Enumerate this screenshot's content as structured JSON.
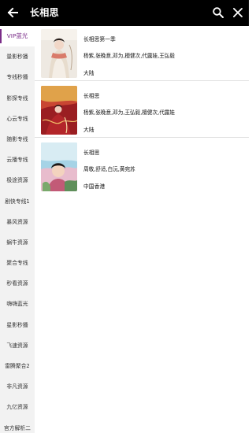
{
  "header": {
    "back_icon": "arrow-left-icon",
    "title": "长相思",
    "search_icon": "search-icon",
    "close_icon": "close-icon"
  },
  "sidebar": {
    "accent_color": "#7a2c88",
    "items": [
      {
        "label": "VIP蓝光",
        "active": true
      },
      {
        "label": "量影秒播"
      },
      {
        "label": "专线秒播"
      },
      {
        "label": "影探专线"
      },
      {
        "label": "心云专线"
      },
      {
        "label": "随影专线"
      },
      {
        "label": "云播专线"
      },
      {
        "label": "极途资源"
      },
      {
        "label": "剧快专线1"
      },
      {
        "label": "暴风资源"
      },
      {
        "label": "蜗牛资源"
      },
      {
        "label": "聚合专线"
      },
      {
        "label": "秒看资源"
      },
      {
        "label": "嗨嗨蓝光"
      },
      {
        "label": "星影秒播"
      },
      {
        "label": "飞速资源"
      },
      {
        "label": "雷腾聚合2"
      },
      {
        "label": "非凡资源"
      },
      {
        "label": "九亿资源"
      },
      {
        "label": "官方解析二"
      }
    ]
  },
  "results": [
    {
      "name": "长相思第一季",
      "cast": "杨紫,张晚意,邓为,檀健次,代露娃,王弘毅",
      "region": "大陆"
    },
    {
      "name": "长相思",
      "cast": "杨紫,张晚意,邓为,王弘毅,檀健次,代露娃",
      "region": "大陆"
    },
    {
      "name": "长相思",
      "cast": "周敬,舒适,白沅,黄宛苏",
      "region": "中国香港"
    }
  ]
}
